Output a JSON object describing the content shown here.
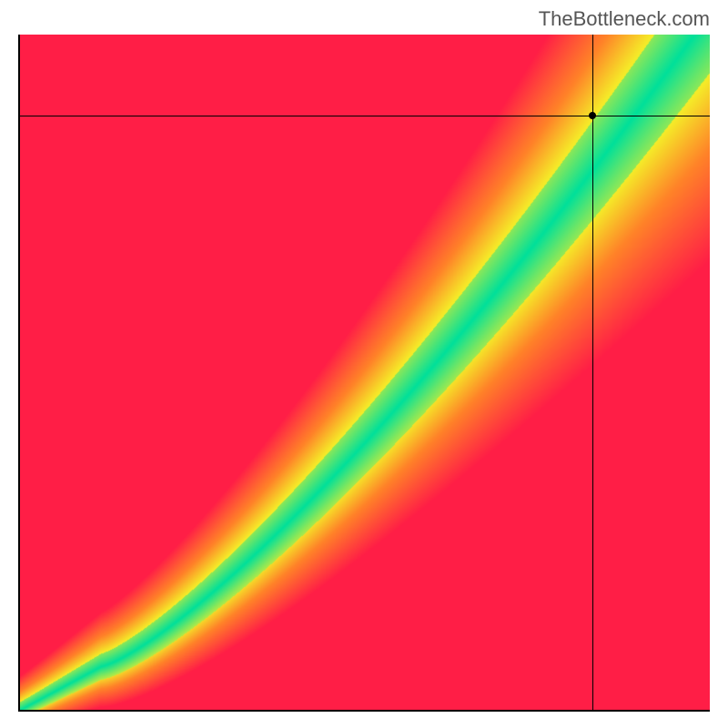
{
  "watermark": "TheBottleneck.com",
  "chart_data": {
    "type": "heatmap",
    "title": "",
    "xlabel": "",
    "ylabel": "",
    "xlim": [
      0,
      100
    ],
    "ylim": [
      0,
      100
    ],
    "crosshair": {
      "x": 83,
      "y": 88
    },
    "colors": {
      "optimal": "#00E09A",
      "near": "#F0F030",
      "mid": "#FF9020",
      "worst": "#FF2040"
    },
    "description": "2D bottleneck heatmap. Green diagonal ridge = balanced; red corners = severe bottleneck. A black crosshair marks a point near the upper-right on the green ridge."
  }
}
